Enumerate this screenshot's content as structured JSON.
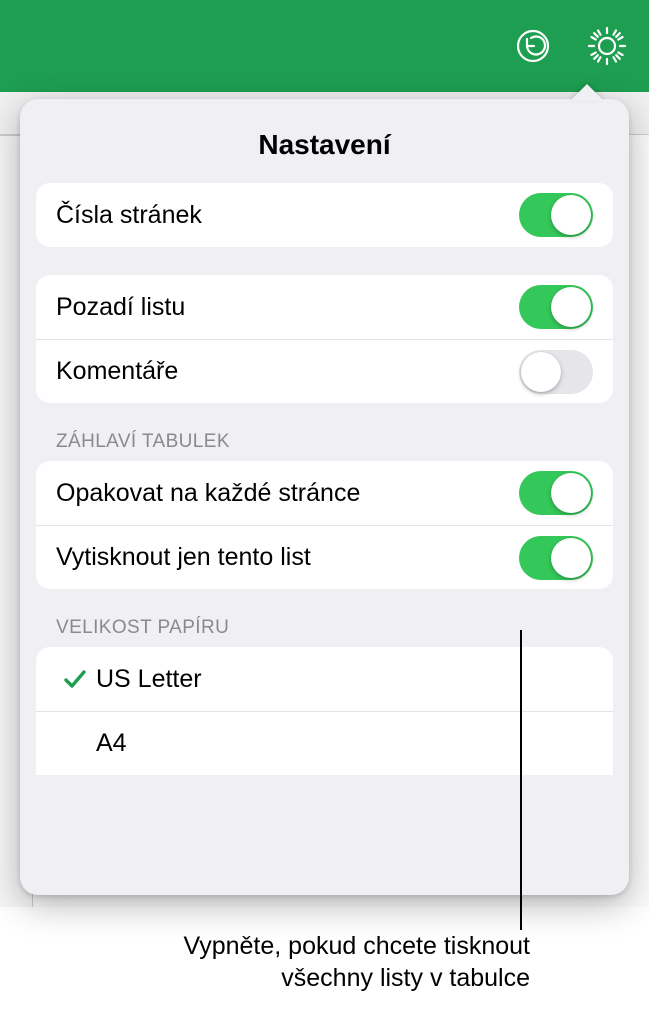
{
  "toolbar": {
    "undo_icon": "undo-icon",
    "settings_icon": "gear-icon"
  },
  "popover": {
    "title": "Nastavení",
    "group1": [
      {
        "label": "Čísla stránek",
        "on": true
      }
    ],
    "group2": [
      {
        "label": "Pozadí listu",
        "on": true
      },
      {
        "label": "Komentáře",
        "on": false
      }
    ],
    "headers_section_title": "ZÁHLAVÍ TABULEK",
    "group3": [
      {
        "label": "Opakovat na každé stránce",
        "on": true
      },
      {
        "label": "Vytisknout jen tento list",
        "on": true
      }
    ],
    "paper_section_title": "VELIKOST PAPÍRU",
    "paper_sizes": [
      {
        "label": "US Letter",
        "selected": true
      },
      {
        "label": "A4",
        "selected": false
      }
    ]
  },
  "callout": {
    "line1": "Vypněte, pokud chcete tisknout",
    "line2": "všechny listy v tabulce"
  }
}
